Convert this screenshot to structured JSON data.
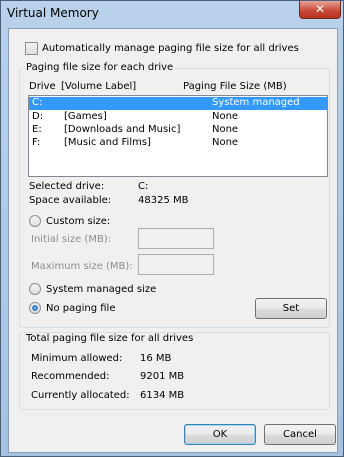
{
  "window": {
    "title": "Virtual Memory",
    "close_glyph": "✕"
  },
  "auto_manage": {
    "label": "Automatically manage paging file size for all drives",
    "checked": false
  },
  "paging_group": {
    "legend": "Paging file size for each drive",
    "col_drive": "Drive",
    "col_volume": "[Volume Label]",
    "col_size": "Paging File Size (MB)",
    "rows": [
      {
        "drive": "C:",
        "label": "",
        "size": "System managed",
        "selected": true
      },
      {
        "drive": "D:",
        "label": "[Games]",
        "size": "None",
        "selected": false
      },
      {
        "drive": "E:",
        "label": "[Downloads and Music]",
        "size": "None",
        "selected": false
      },
      {
        "drive": "F:",
        "label": "[Music and Films]",
        "size": "None",
        "selected": false
      }
    ],
    "selected_drive_label": "Selected drive:",
    "selected_drive_value": "C:",
    "space_available_label": "Space available:",
    "space_available_value": "48325 MB",
    "custom_size_label": "Custom size:",
    "initial_size_label": "Initial size (MB):",
    "initial_size_value": "",
    "maximum_size_label": "Maximum size (MB):",
    "maximum_size_value": "",
    "system_managed_label": "System managed size",
    "no_paging_label": "No paging file",
    "selected_option": "no_paging",
    "set_button": "Set"
  },
  "total_group": {
    "legend": "Total paging file size for all drives",
    "min_label": "Minimum allowed:",
    "min_value": "16 MB",
    "recommended_label": "Recommended:",
    "recommended_value": "9201 MB",
    "allocated_label": "Currently allocated:",
    "allocated_value": "6134 MB"
  },
  "buttons": {
    "ok": "OK",
    "cancel": "Cancel"
  },
  "colors": {
    "selection": "#3399ff",
    "titlebar": "#b9d1ea",
    "close": "#c94a3a"
  }
}
